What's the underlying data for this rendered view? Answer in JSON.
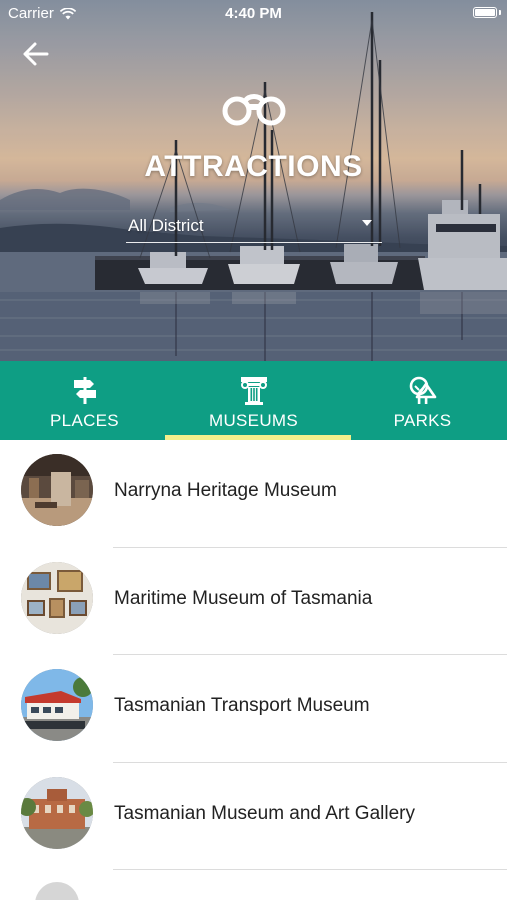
{
  "status_bar": {
    "carrier": "Carrier",
    "time": "4:40 PM"
  },
  "header": {
    "title": "ATTRACTIONS",
    "icon": "binoculars-icon",
    "back_icon": "arrow-left-icon"
  },
  "district_filter": {
    "selected": "All District"
  },
  "tabs": [
    {
      "label": "PLACES",
      "icon": "signpost-icon",
      "active": false
    },
    {
      "label": "MUSEUMS",
      "icon": "column-icon",
      "active": true
    },
    {
      "label": "PARKS",
      "icon": "trees-icon",
      "active": false
    }
  ],
  "museums": [
    {
      "name": "Narryna Heritage Museum"
    },
    {
      "name": "Maritime Museum of Tasmania"
    },
    {
      "name": "Tasmanian Transport Museum"
    },
    {
      "name": "Tasmanian Museum and Art Gallery"
    }
  ],
  "colors": {
    "tab_bar": "#0e9e84",
    "tab_indicator": "#f4ef8c",
    "text_primary": "#222222"
  }
}
